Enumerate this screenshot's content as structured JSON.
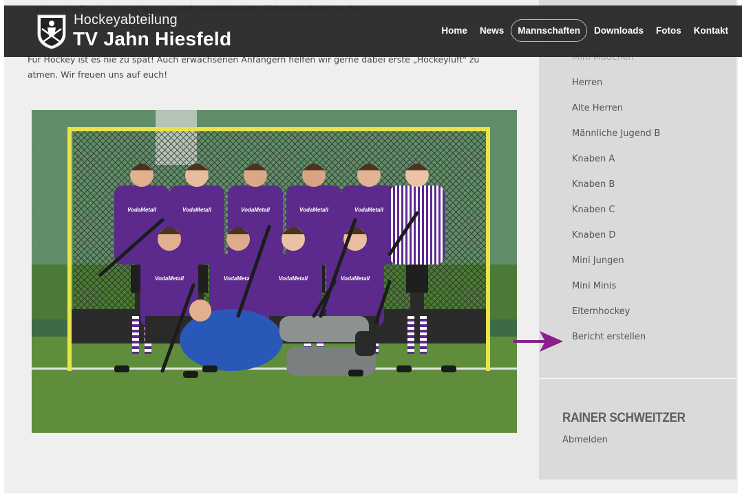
{
  "header": {
    "brand_top": "Hockeyabteilung",
    "brand_main": "TV Jahn Hiesfeld",
    "nav": [
      {
        "label": "Home",
        "active": false
      },
      {
        "label": "News",
        "active": false
      },
      {
        "label": "Mannschaften",
        "active": true
      },
      {
        "label": "Downloads",
        "active": false
      },
      {
        "label": "Fotos",
        "active": false
      },
      {
        "label": "Kontakt",
        "active": false
      }
    ]
  },
  "content": {
    "text_line1": "…Mannschaften im Erwachsenen- und Jugendbereich zählen wir damit zu den",
    "text_line2": "Für Hockey ist es nie zu spät! Auch erwachsenen Anfängern helfen wir gerne dabei erste „Hockeyluft\" zu",
    "text_line3": "atmen. Wir freuen uns auf euch!",
    "jersey_text": "VodaMetall"
  },
  "sidebar": {
    "menu": [
      {
        "label": "Mini Mädchen",
        "cut": true
      },
      {
        "label": "Herren",
        "cut": false
      },
      {
        "label": "Alte Herren",
        "cut": false
      },
      {
        "label": "Männliche Jugend B",
        "cut": false
      },
      {
        "label": "Knaben A",
        "cut": false
      },
      {
        "label": "Knaben B",
        "cut": false
      },
      {
        "label": "Knaben C",
        "cut": false
      },
      {
        "label": "Knaben D",
        "cut": false
      },
      {
        "label": "Mini Jungen",
        "cut": false
      },
      {
        "label": "Mini Minis",
        "cut": false
      },
      {
        "label": "Elternhockey",
        "cut": false
      },
      {
        "label": "Bericht erstellen",
        "cut": false
      }
    ],
    "user_name": "RAINER SCHWEITZER",
    "logout_label": "Abmelden"
  },
  "colors": {
    "arrow": "#8a1e8c",
    "jersey": "#5b2a8c",
    "header_bg": "#222222"
  }
}
